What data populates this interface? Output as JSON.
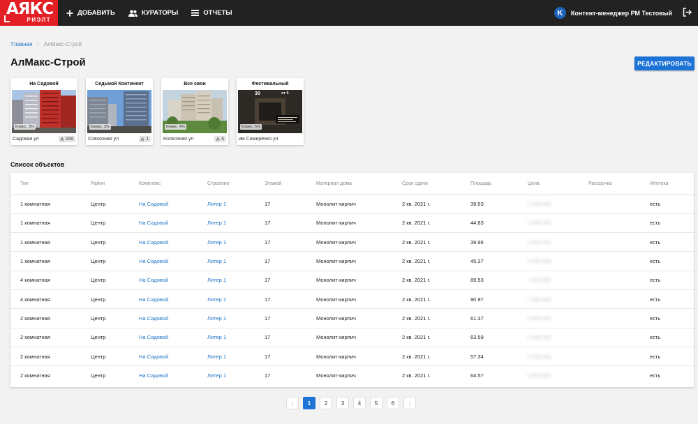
{
  "brand": {
    "main": "АЯКС",
    "sub": "РИЭЛТ"
  },
  "nav": [
    {
      "label": "ДОБАВИТЬ",
      "icon": "plus-icon"
    },
    {
      "label": "КУРАТОРЫ",
      "icon": "users-icon"
    },
    {
      "label": "ОТЧЕТЫ",
      "icon": "list-icon"
    }
  ],
  "user": {
    "initial": "K",
    "name": "Контент-менеджер РМ Тестовый"
  },
  "breadcrumb": {
    "home": "Главная",
    "separator": "/",
    "current": "АлМакс-Строй"
  },
  "page_title": "АлМакс-Строй",
  "edit_button": "РЕДАКТИРОВАТЬ",
  "complexes": [
    {
      "name": "На Садовой",
      "commission": "Комис. 3%",
      "address": "Садовая ул",
      "house": "д. 159"
    },
    {
      "name": "Седьмой Континент",
      "commission": "Комис. 3%",
      "address": "Совхозная ул",
      "house": "д. 1"
    },
    {
      "name": "Все свои",
      "commission": "Комис. 4%",
      "address": "Колхозная ул",
      "house": "д. 5"
    },
    {
      "name": "Фестивальный",
      "commission": "Комис. 5%",
      "address": "им Симиренко ул",
      "house": "",
      "promo_left": "30",
      "promo_right": "от 5"
    }
  ],
  "list_title": "Список объектов",
  "table": {
    "columns": [
      "Тип",
      "Район",
      "Комплекс",
      "Строение",
      "Этажей",
      "Материал дома",
      "Срок сдачи",
      "Площадь",
      "Цена",
      "Рассрочка",
      "Ипотека"
    ],
    "rows": [
      [
        "1 комнатная",
        "Центр",
        "На Садовой",
        "Литер 1",
        "17",
        "Монолит-кирпич",
        "2 кв. 2021 г.",
        "39.53",
        "3 000 000",
        "",
        "есть"
      ],
      [
        "1 комнатная",
        "Центр",
        "На Садовой",
        "Литер 1",
        "17",
        "Монолит-кирпич",
        "2 кв. 2021 г.",
        "44.83",
        "3 000 000",
        "",
        "есть"
      ],
      [
        "1 комнатная",
        "Центр",
        "На Садовой",
        "Литер 1",
        "17",
        "Монолит-кирпич",
        "2 кв. 2021 г.",
        "39.96",
        "3 000 000",
        "",
        "есть"
      ],
      [
        "1 комнатная",
        "Центр",
        "На Садовой",
        "Литер 1",
        "17",
        "Монолит-кирпич",
        "2 кв. 2021 г.",
        "45.37",
        "3 000 000",
        "",
        "есть"
      ],
      [
        "4 комнатная",
        "Центр",
        "На Садовой",
        "Литер 1",
        "17",
        "Монолит-кирпич",
        "2 кв. 2021 г.",
        "89.53",
        "7 000 000",
        "",
        "есть"
      ],
      [
        "4 комнатная",
        "Центр",
        "На Садовой",
        "Литер 1",
        "17",
        "Монолит-кирпич",
        "2 кв. 2021 г.",
        "90.97",
        "7 000 000",
        "",
        "есть"
      ],
      [
        "2 комнатная",
        "Центр",
        "На Садовой",
        "Литер 1",
        "17",
        "Монолит-кирпич",
        "2 кв. 2021 г.",
        "61.37",
        "5 000 000",
        "",
        "есть"
      ],
      [
        "2 комнатная",
        "Центр",
        "На Садовой",
        "Литер 1",
        "17",
        "Монолит-кирпич",
        "2 кв. 2021 г.",
        "63.59",
        "5 000 000",
        "",
        "есть"
      ],
      [
        "2 комнатная",
        "Центр",
        "На Садовой",
        "Литер 1",
        "17",
        "Монолит-кирпич",
        "2 кв. 2021 г.",
        "57.34",
        "5 000 000",
        "",
        "есть"
      ],
      [
        "2 комнатная",
        "Центр",
        "На Садовой",
        "Литер 1",
        "17",
        "Монолит-кирпич",
        "2 кв. 2021 г.",
        "64.57",
        "5 000 000",
        "",
        "есть"
      ]
    ]
  },
  "pagination": {
    "prev": "‹",
    "next": "›",
    "pages": [
      "1",
      "2",
      "3",
      "4",
      "5",
      "6"
    ],
    "active": "1"
  },
  "colors": {
    "brand_red": "#e31e24",
    "topbar": "#222222",
    "accent_blue": "#1e74d6",
    "link_blue": "#1e74c6",
    "background": "#f2f2f2"
  }
}
